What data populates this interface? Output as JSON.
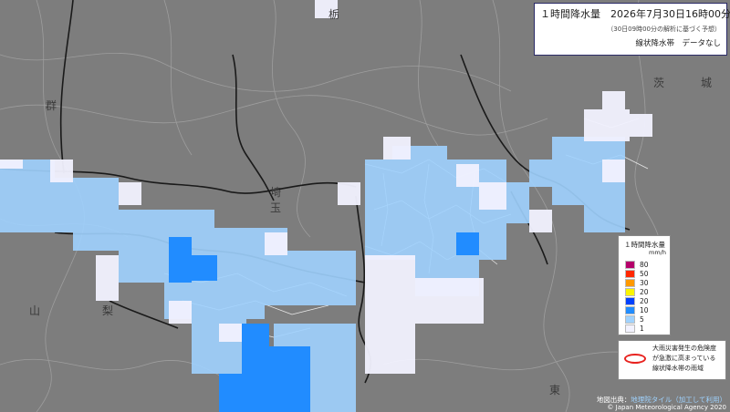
{
  "info": {
    "title": "１時間降水量　2026年7月30日16時00分まで",
    "subtitle": "（30日09時00分の解析に基づく予想）",
    "status": "線状降水帯　データなし"
  },
  "legend": {
    "title": "１時間降水量",
    "unit": "mm/h",
    "items": [
      {
        "label": "80",
        "color": "#b4006a"
      },
      {
        "label": "50",
        "color": "#ff2800"
      },
      {
        "label": "30",
        "color": "#ff9900"
      },
      {
        "label": "20",
        "color": "#faf500"
      },
      {
        "label": "20",
        "color": "#0041ff"
      },
      {
        "label": "10",
        "color": "#218cff"
      },
      {
        "label": "5",
        "color": "#a0d2ff"
      },
      {
        "label": "1",
        "color": "#f2f2ff"
      }
    ]
  },
  "hazard": {
    "line1": "大雨災害発生の危険度",
    "line2": "が急激に高まっている",
    "line3": "線状降水帯の雨域",
    "color": "#e8231f"
  },
  "attribution": {
    "label": "地図出典：",
    "link": "地理院タイル（加工して利用）",
    "copyright": "© Japan Meteorological Agency 2020"
  },
  "map": {
    "background": "#7d7d7d",
    "place_labels": [
      "茨",
      "城",
      "埼",
      "玉",
      "山",
      "梨",
      "東",
      "栃",
      "群"
    ]
  }
}
